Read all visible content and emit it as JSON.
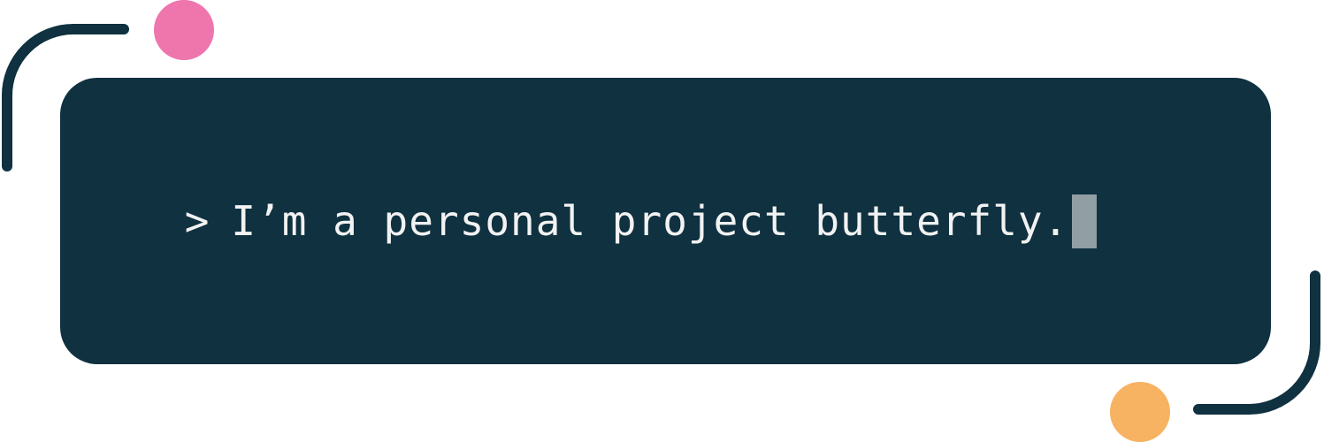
{
  "terminal": {
    "prompt": ">",
    "text": "I’m a personal project butterfly.",
    "background_color": "#0f3140",
    "text_color": "#f2f2f2",
    "cursor_color": "#919ea3"
  },
  "decorations": {
    "arc_color": "#0f3140",
    "dot_pink_color": "#ef75ad",
    "dot_orange_color": "#f7b262"
  }
}
